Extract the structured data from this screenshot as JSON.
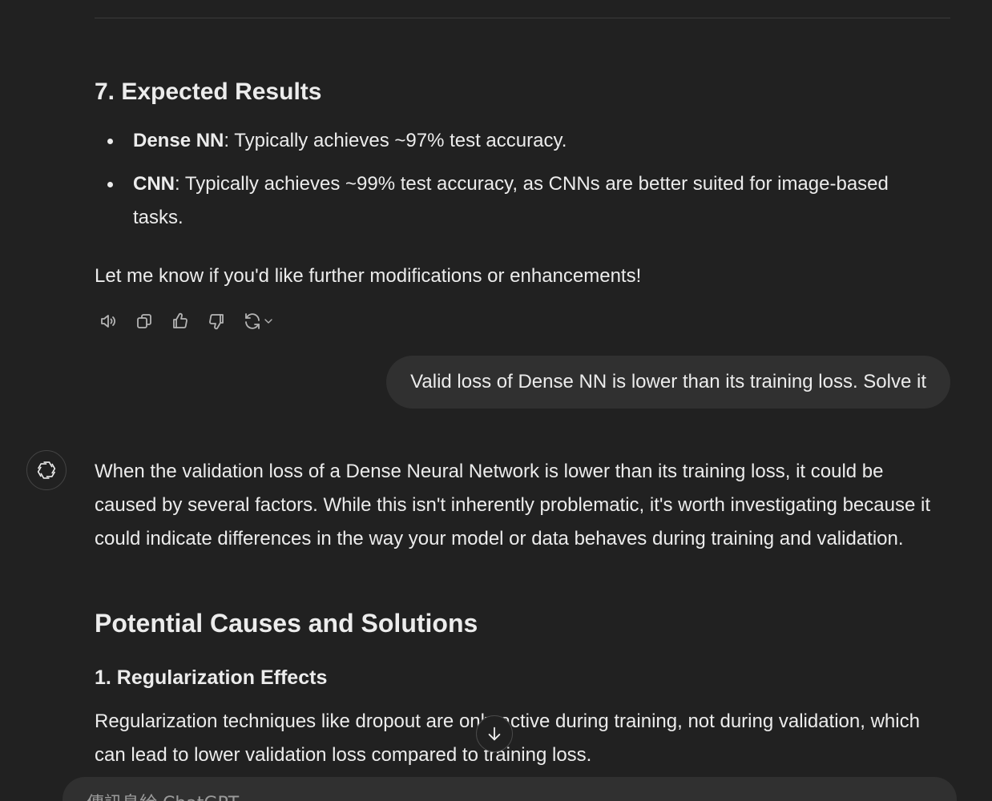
{
  "section7": {
    "heading": "7. Expected Results",
    "bullets": [
      {
        "term": "Dense NN",
        "text": ": Typically achieves ~97% test accuracy."
      },
      {
        "term": "CNN",
        "text": ": Typically achieves ~99% test accuracy, as CNNs are better suited for image-based tasks."
      }
    ],
    "closing": "Let me know if you'd like further modifications or enhancements!"
  },
  "actions": {
    "icons": [
      "read-aloud-icon",
      "copy-icon",
      "thumbs-up-icon",
      "thumbs-down-icon",
      "regenerate-icon",
      "chevron-down-icon"
    ]
  },
  "user_message": "Valid loss of Dense NN is lower than its training loss. Solve it",
  "assistant": {
    "intro": "When the validation loss of a Dense Neural Network is lower than its training loss, it could be caused by several factors. While this isn't inherently problematic, it's worth investigating because it could indicate differences in the way your model or data behaves during training and validation.",
    "heading": "Potential Causes and Solutions",
    "subheading": "1. Regularization Effects",
    "paragraph": "Regularization techniques like dropout are only active during training, not during validation, which can lead to lower validation loss compared to training loss."
  },
  "composer": {
    "placeholder": "傳訊息給 ChatGPT"
  },
  "colors": {
    "background": "#212121",
    "bubble": "#303030",
    "text": "#ececec"
  }
}
